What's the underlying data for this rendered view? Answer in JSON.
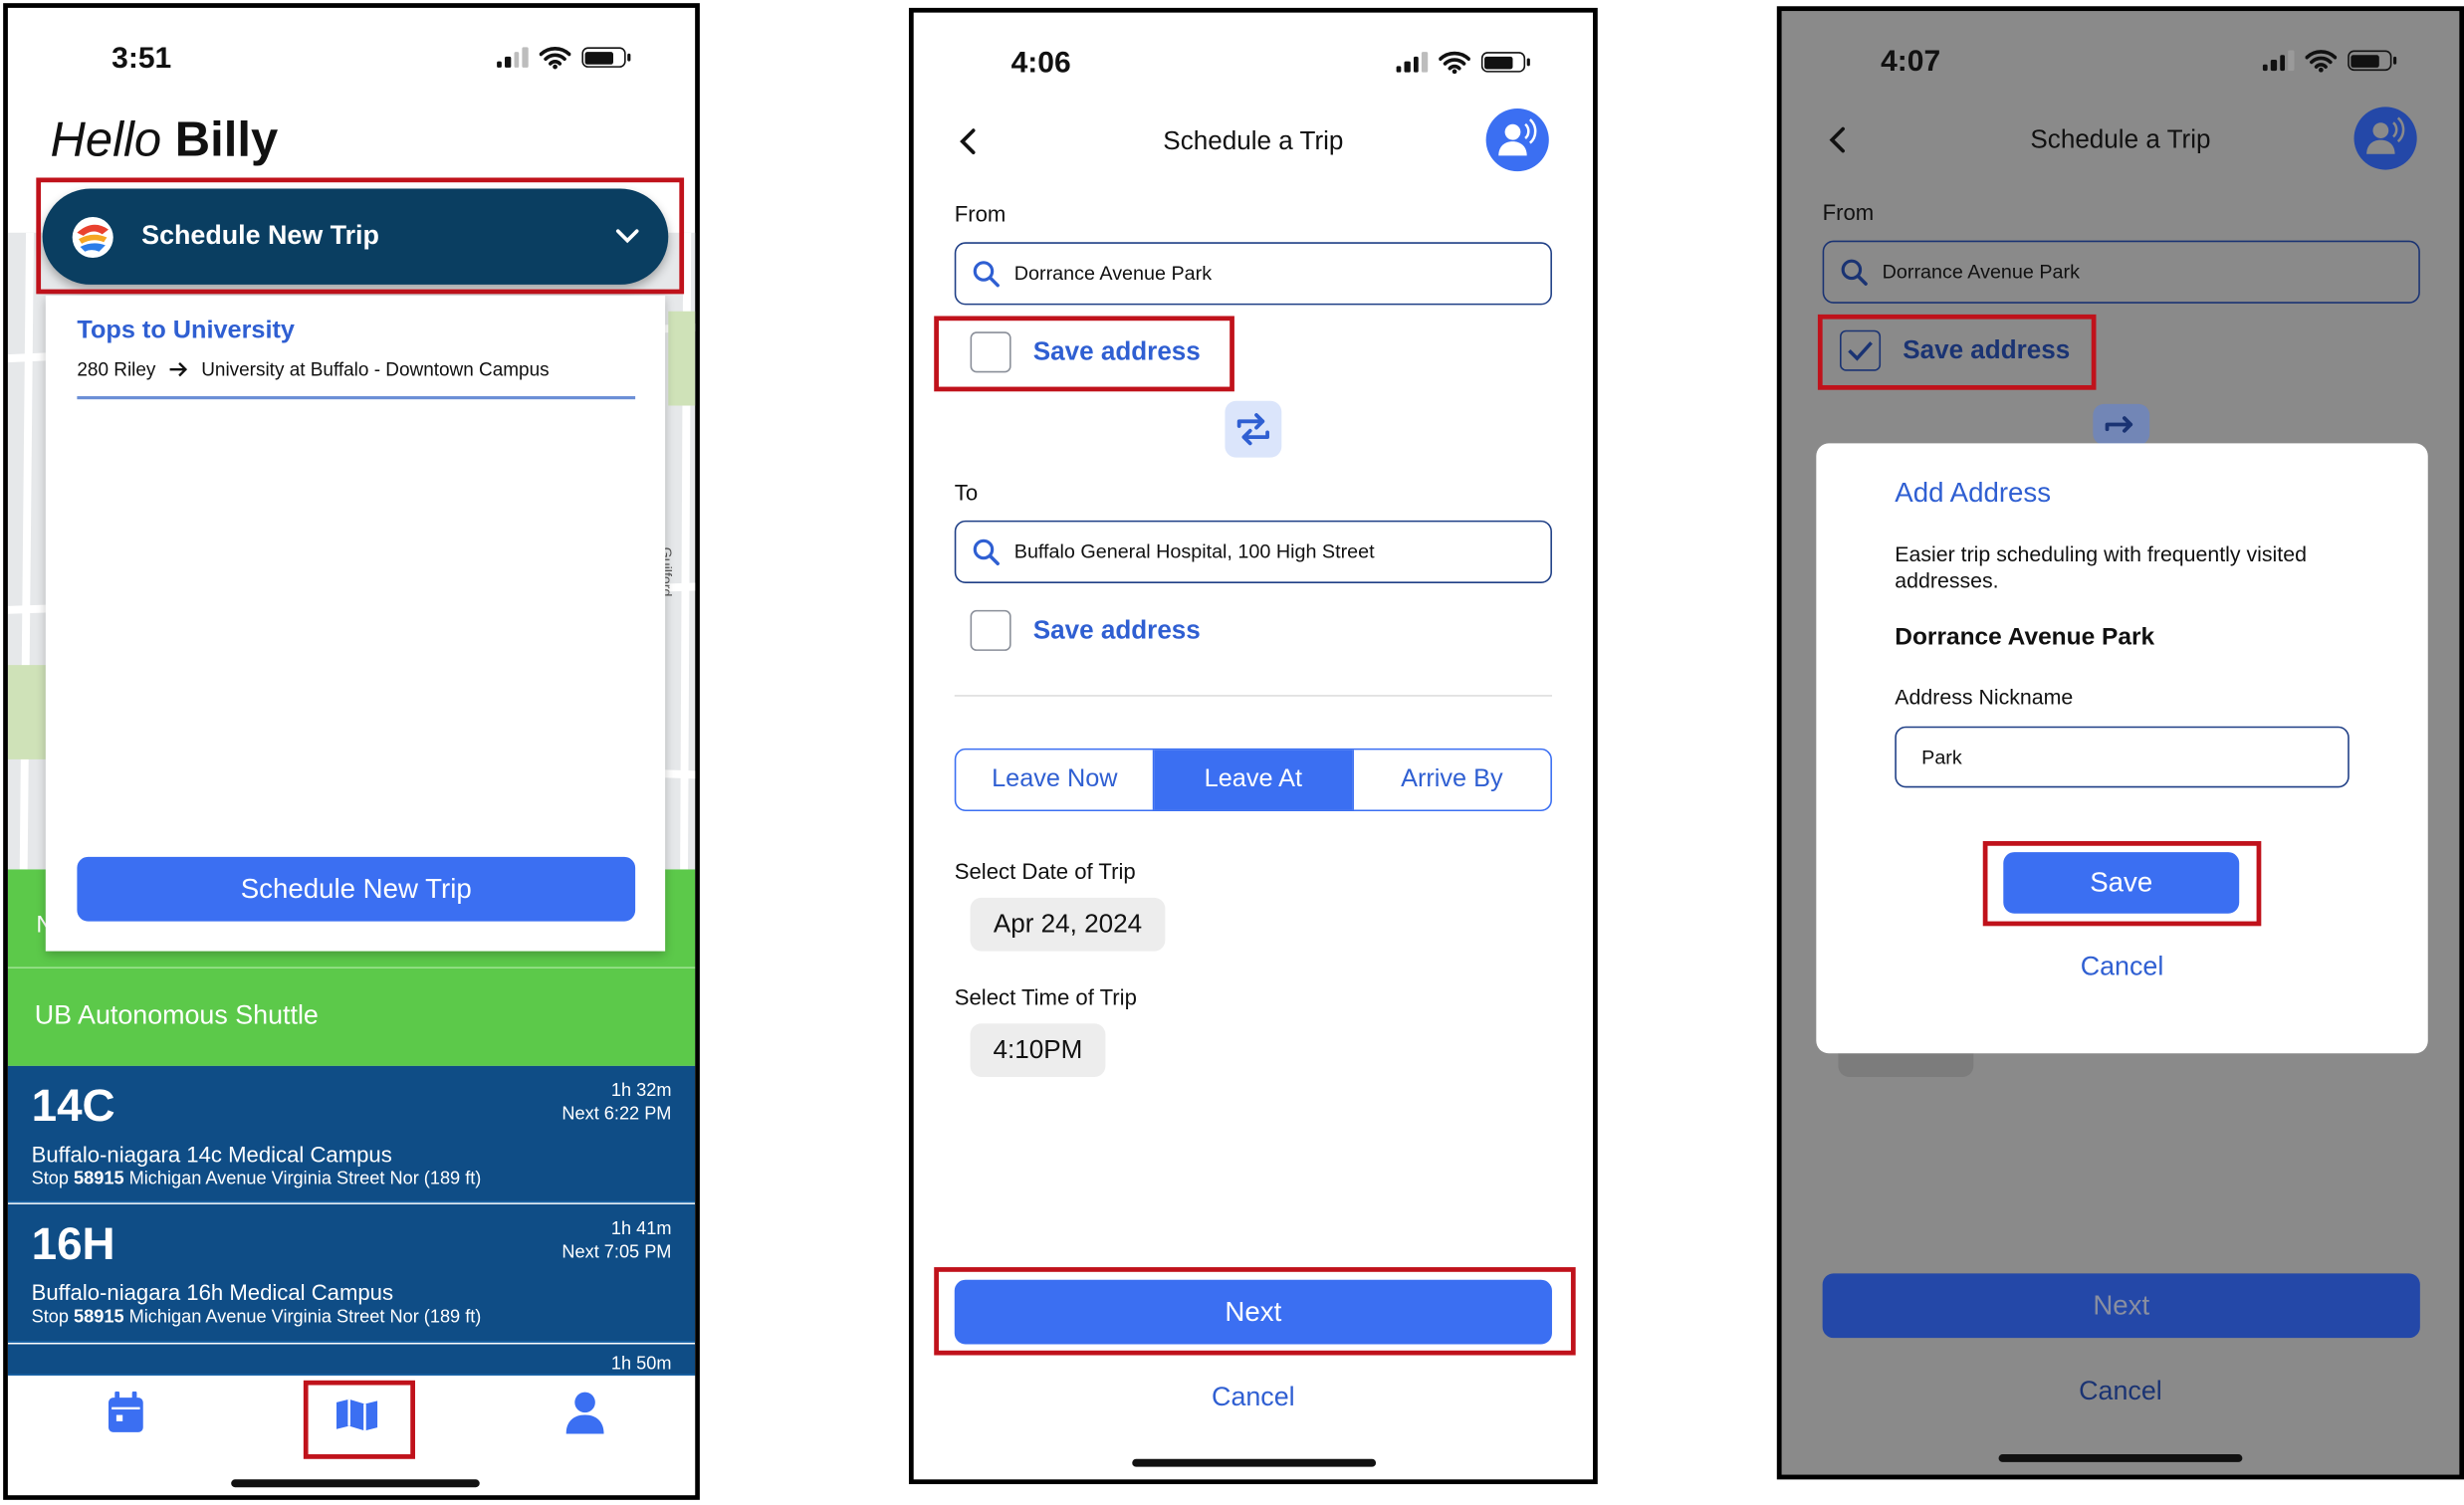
{
  "colors": {
    "accent": "#3b6ff2",
    "highlight": "#c0121b",
    "navy": "#0f4d86",
    "green": "#5cc94a",
    "dark_teal": "#0a3e61"
  },
  "screen1": {
    "time": "3:51",
    "greeting_hello": "Hello",
    "greeting_name": "Billy",
    "schedule_header": "Schedule New Trip",
    "trip_title": "Tops to University",
    "trip_from": "280 Riley",
    "trip_to": "University at Buffalo - Downtown Campus",
    "schedule_button": "Schedule New Trip",
    "map_labels": {
      "guilford": "Guilford St",
      "n": "N"
    },
    "shuttle": "UB Autonomous Shuttle",
    "routes": [
      {
        "number": "14C",
        "duration": "1h 32m",
        "next": "Next 6:22 PM",
        "name": "Buffalo-niagara 14c Medical Campus",
        "stop_prefix": "Stop",
        "stop_id": "58915",
        "stop_desc": "Michigan Avenue Virginia Street Nor (189 ft)"
      },
      {
        "number": "16H",
        "duration": "1h 41m",
        "next": "Next 7:05 PM",
        "name": "Buffalo-niagara 16h Medical Campus",
        "stop_prefix": "Stop",
        "stop_id": "58915",
        "stop_desc": "Michigan Avenue Virginia Street Nor (189 ft)"
      },
      {
        "number": "",
        "duration": "1h 50m"
      }
    ],
    "tabbar": [
      "calendar-icon",
      "map-icon",
      "profile-icon"
    ]
  },
  "screen2": {
    "time": "4:06",
    "title": "Schedule a Trip",
    "from_label": "From",
    "from_value": "Dorrance Avenue Park",
    "save_address": "Save address",
    "to_label": "To",
    "to_value": "Buffalo General Hospital, 100 High Street",
    "segments": [
      "Leave Now",
      "Leave At",
      "Arrive By"
    ],
    "selected_segment": "Leave At",
    "date_label": "Select Date of Trip",
    "date_value": "Apr 24, 2024",
    "time_label": "Select Time of Trip",
    "time_value": "4:10PM",
    "next": "Next",
    "cancel": "Cancel"
  },
  "screen3": {
    "time": "4:07",
    "title": "Schedule a Trip",
    "from_label": "From",
    "from_value": "Dorrance Avenue Park",
    "save_address": "Save address",
    "save_checked": true,
    "dialog_title": "Add Address",
    "dialog_desc": "Easier trip scheduling with frequently visited addresses.",
    "dialog_place": "Dorrance Avenue Park",
    "nickname_label": "Address Nickname",
    "nickname_value": "Park",
    "save": "Save",
    "cancel": "Cancel",
    "next": "Next",
    "cancel_bottom": "Cancel"
  }
}
